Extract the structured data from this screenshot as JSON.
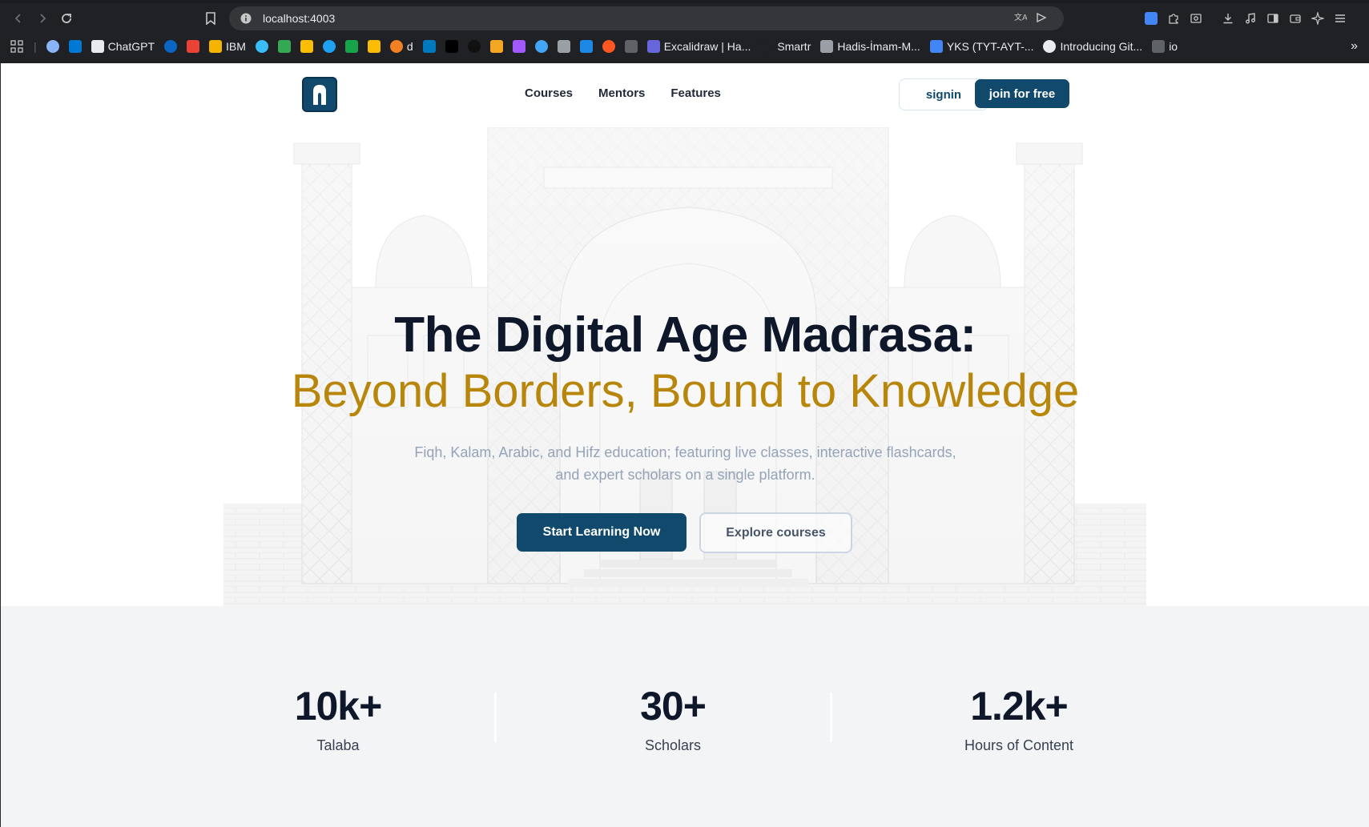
{
  "browser": {
    "url": "localhost:4003",
    "bookmarks": [
      {
        "label": "",
        "color": "#8ab4f8"
      },
      {
        "label": "",
        "color": "#0078d4"
      },
      {
        "label": "ChatGPT",
        "color": "#e8eaed"
      },
      {
        "label": "",
        "color": "#0a66c2"
      },
      {
        "label": "",
        "color": "#ea4335"
      },
      {
        "label": "IBM",
        "color": "#f4b400"
      },
      {
        "label": "",
        "color": "#38bdf8"
      },
      {
        "label": "",
        "color": "#34a853"
      },
      {
        "label": "",
        "color": "#fbbc04"
      },
      {
        "label": "",
        "color": "#1da1f2"
      },
      {
        "label": "",
        "color": "#16a34a"
      },
      {
        "label": "",
        "color": "#fbbc05"
      },
      {
        "label": "d",
        "color": "#f48024"
      },
      {
        "label": "",
        "color": "#0079bf"
      },
      {
        "label": "",
        "color": "#000000"
      },
      {
        "label": "",
        "color": "#111111"
      },
      {
        "label": "",
        "color": "#f5a623"
      },
      {
        "label": "",
        "color": "#a259ff"
      },
      {
        "label": "",
        "color": "#42a5f5"
      },
      {
        "label": "",
        "color": "#9aa0a6"
      },
      {
        "label": "",
        "color": "#1e88e5"
      },
      {
        "label": "",
        "color": "#ff5722"
      },
      {
        "label": "",
        "color": "#5f6368"
      },
      {
        "label": "Excalidraw | Ha...",
        "color": "#6965db"
      },
      {
        "label": "Smartr",
        "color": "#202124"
      },
      {
        "label": "Hadis-İmam-M...",
        "color": "#9aa0a6"
      },
      {
        "label": "YKS (TYT-AYT-...",
        "color": "#4285f4"
      },
      {
        "label": "Introducing Git...",
        "color": "#e8eaed"
      },
      {
        "label": "io",
        "color": "#5f6368"
      }
    ],
    "more": "»"
  },
  "header": {
    "nav": [
      "Courses",
      "Mentors",
      "Features"
    ],
    "signin_label": "signin",
    "join_label": "join for free"
  },
  "hero": {
    "title": "The Digital Age Madrasa:",
    "subtitle": "Beyond Borders, Bound to Knowledge",
    "description": "Fiqh, Kalam, Arabic, and Hifz education; featuring live classes, interactive flashcards, and expert scholars on a single platform.",
    "start_label": "Start Learning Now",
    "explore_label": "Explore courses"
  },
  "stats": [
    {
      "value": "10k+",
      "label": "Talaba"
    },
    {
      "value": "30+",
      "label": "Scholars"
    },
    {
      "value": "1.2k+",
      "label": "Hours of Content"
    }
  ],
  "colors": {
    "primary": "#10496b",
    "accent": "#b8860b",
    "stats_bg": "#f3f4f6"
  }
}
